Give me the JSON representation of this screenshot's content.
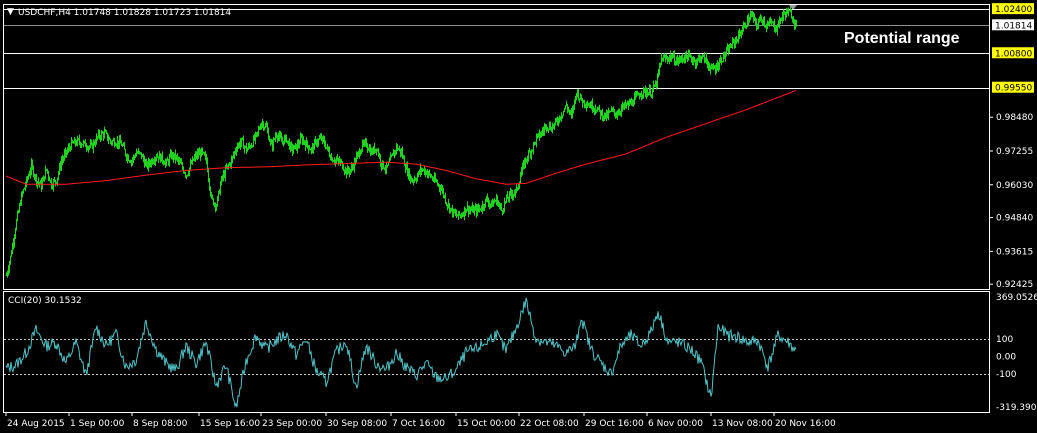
{
  "chart_data": [
    {
      "type": "bar",
      "subtype": "ohlc",
      "symbol_header": "USDCHF,H4  1.01748 1.01828 1.01723 1.01814",
      "annotation": "Potential range",
      "ylim": [
        0.9225,
        1.0255
      ],
      "y_ticks": [
        "0.92425",
        "0.93615",
        "0.94840",
        "0.96030",
        "0.97255",
        "0.98480"
      ],
      "y_tick_values": [
        0.92425,
        0.93615,
        0.9484,
        0.9603,
        0.97255,
        0.9848
      ],
      "current_price": {
        "label": "1.01814",
        "value": 1.01814,
        "color": "#000000",
        "bg": "#ffffff"
      },
      "levels": [
        {
          "label": "1.02400",
          "value": 1.024,
          "color": "#ffffff",
          "badge": "#ffff00"
        },
        {
          "label": "1.00800",
          "value": 1.008,
          "color": "#ffffff",
          "badge": "#ffff00"
        },
        {
          "label": "0.99550",
          "value": 0.9955,
          "color": "#ffffff",
          "badge": "#ffff00"
        }
      ],
      "price_anchors": [
        [
          0,
          0.9275
        ],
        [
          4,
          0.934
        ],
        [
          10,
          0.947
        ],
        [
          15,
          0.956
        ],
        [
          20,
          0.9615
        ],
        [
          25,
          0.967
        ],
        [
          30,
          0.962
        ],
        [
          35,
          0.96
        ],
        [
          40,
          0.966
        ],
        [
          45,
          0.9605
        ],
        [
          50,
          0.962
        ],
        [
          55,
          0.969
        ],
        [
          60,
          0.972
        ],
        [
          65,
          0.975
        ],
        [
          72,
          0.976
        ],
        [
          78,
          0.975
        ],
        [
          85,
          0.974
        ],
        [
          92,
          0.978
        ],
        [
          98,
          0.979
        ],
        [
          104,
          0.976
        ],
        [
          110,
          0.976
        ],
        [
          115,
          0.975
        ],
        [
          120,
          0.971
        ],
        [
          125,
          0.969
        ],
        [
          130,
          0.972
        ],
        [
          135,
          0.971
        ],
        [
          140,
          0.967
        ],
        [
          145,
          0.969
        ],
        [
          150,
          0.971
        ],
        [
          155,
          0.97
        ],
        [
          160,
          0.968
        ],
        [
          165,
          0.971
        ],
        [
          170,
          0.97
        ],
        [
          175,
          0.967
        ],
        [
          180,
          0.964
        ],
        [
          185,
          0.968
        ],
        [
          190,
          0.971
        ],
        [
          195,
          0.972
        ],
        [
          200,
          0.969
        ],
        [
          205,
          0.955
        ],
        [
          210,
          0.953
        ],
        [
          215,
          0.962
        ],
        [
          220,
          0.966
        ],
        [
          225,
          0.969
        ],
        [
          230,
          0.974
        ],
        [
          235,
          0.976
        ],
        [
          240,
          0.973
        ],
        [
          245,
          0.975
        ],
        [
          250,
          0.978
        ],
        [
          255,
          0.983
        ],
        [
          260,
          0.981
        ],
        [
          265,
          0.974
        ],
        [
          270,
          0.979
        ],
        [
          275,
          0.976
        ],
        [
          280,
          0.977
        ],
        [
          285,
          0.973
        ],
        [
          290,
          0.974
        ],
        [
          295,
          0.977
        ],
        [
          300,
          0.975
        ],
        [
          305,
          0.973
        ],
        [
          310,
          0.976
        ],
        [
          315,
          0.977
        ],
        [
          320,
          0.974
        ],
        [
          325,
          0.97
        ],
        [
          330,
          0.969
        ],
        [
          335,
          0.968
        ],
        [
          340,
          0.965
        ],
        [
          345,
          0.966
        ],
        [
          350,
          0.97
        ],
        [
          355,
          0.974
        ],
        [
          360,
          0.975
        ],
        [
          365,
          0.972
        ],
        [
          370,
          0.974
        ],
        [
          375,
          0.968
        ],
        [
          380,
          0.966
        ],
        [
          385,
          0.97
        ],
        [
          390,
          0.974
        ],
        [
          395,
          0.972
        ],
        [
          400,
          0.966
        ],
        [
          405,
          0.962
        ],
        [
          410,
          0.963
        ],
        [
          415,
          0.966
        ],
        [
          420,
          0.965
        ],
        [
          425,
          0.963
        ],
        [
          430,
          0.961
        ],
        [
          435,
          0.959
        ],
        [
          440,
          0.954
        ],
        [
          445,
          0.951
        ],
        [
          450,
          0.949
        ],
        [
          455,
          0.9495
        ],
        [
          460,
          0.952
        ],
        [
          465,
          0.951
        ],
        [
          470,
          0.951
        ],
        [
          475,
          0.952
        ],
        [
          480,
          0.955
        ],
        [
          485,
          0.953
        ],
        [
          490,
          0.955
        ],
        [
          495,
          0.951
        ],
        [
          500,
          0.955
        ],
        [
          505,
          0.957
        ],
        [
          510,
          0.958
        ],
        [
          515,
          0.965
        ],
        [
          520,
          0.97
        ],
        [
          525,
          0.973
        ],
        [
          530,
          0.977
        ],
        [
          535,
          0.979
        ],
        [
          540,
          0.982
        ],
        [
          545,
          0.981
        ],
        [
          550,
          0.983
        ],
        [
          555,
          0.986
        ],
        [
          560,
          0.989
        ],
        [
          565,
          0.985
        ],
        [
          570,
          0.994
        ],
        [
          575,
          0.991
        ],
        [
          580,
          0.99
        ],
        [
          585,
          0.989
        ],
        [
          590,
          0.988
        ],
        [
          595,
          0.986
        ],
        [
          600,
          0.985
        ],
        [
          605,
          0.987
        ],
        [
          610,
          0.986
        ],
        [
          615,
          0.988
        ],
        [
          620,
          0.989
        ],
        [
          625,
          0.99
        ],
        [
          630,
          0.992
        ],
        [
          635,
          0.994
        ],
        [
          640,
          0.994
        ],
        [
          645,
          0.994
        ],
        [
          650,
          0.997
        ],
        [
          655,
          1.006
        ],
        [
          660,
          1.006
        ],
        [
          665,
          1.007
        ],
        [
          670,
          1.005
        ],
        [
          675,
          1.006
        ],
        [
          680,
          1.007
        ],
        [
          685,
          1.006
        ],
        [
          690,
          1.005
        ],
        [
          695,
          1.007
        ],
        [
          700,
          1.005
        ],
        [
          705,
          1.002
        ],
        [
          710,
          1.003
        ],
        [
          715,
          1.006
        ],
        [
          720,
          1.008
        ],
        [
          725,
          1.011
        ],
        [
          730,
          1.013
        ],
        [
          735,
          1.016
        ],
        [
          740,
          1.019
        ],
        [
          745,
          1.022
        ],
        [
          750,
          1.018
        ],
        [
          755,
          1.021
        ],
        [
          760,
          1.018
        ],
        [
          765,
          1.019
        ],
        [
          770,
          1.017
        ],
        [
          775,
          1.021
        ],
        [
          780,
          1.023
        ],
        [
          785,
          1.022
        ],
        [
          790,
          1.018
        ]
      ],
      "moving_average": {
        "color": "#ff1a1a",
        "anchors": [
          [
            0,
            0.9635
          ],
          [
            20,
            0.9605
          ],
          [
            60,
            0.9605
          ],
          [
            100,
            0.9618
          ],
          [
            140,
            0.9638
          ],
          [
            180,
            0.9655
          ],
          [
            220,
            0.9665
          ],
          [
            260,
            0.9668
          ],
          [
            300,
            0.9675
          ],
          [
            340,
            0.968
          ],
          [
            380,
            0.9685
          ],
          [
            410,
            0.9678
          ],
          [
            440,
            0.9655
          ],
          [
            470,
            0.9625
          ],
          [
            500,
            0.9605
          ],
          [
            520,
            0.9608
          ],
          [
            550,
            0.9645
          ],
          [
            580,
            0.9678
          ],
          [
            620,
            0.9715
          ],
          [
            660,
            0.9775
          ],
          [
            700,
            0.9825
          ],
          [
            740,
            0.9875
          ],
          [
            790,
            0.9945
          ]
        ]
      }
    },
    {
      "type": "line",
      "indicator": "CCI(20) 30.1532",
      "ylim": [
        -319.39,
        369.0526
      ],
      "y_ticks": [
        "369.0526",
        "100",
        "0.00",
        "-100",
        "-319.3906"
      ],
      "y_tick_values": [
        369.0526,
        100,
        0,
        -100,
        -319.39
      ],
      "series_color": "#4fc3c8",
      "dotted_levels": [
        100,
        -100
      ],
      "cci_anchors": [
        [
          0,
          -70
        ],
        [
          10,
          -50
        ],
        [
          20,
          20
        ],
        [
          30,
          150
        ],
        [
          40,
          60
        ],
        [
          50,
          80
        ],
        [
          60,
          -40
        ],
        [
          70,
          80
        ],
        [
          80,
          -110
        ],
        [
          90,
          170
        ],
        [
          100,
          60
        ],
        [
          110,
          130
        ],
        [
          120,
          -60
        ],
        [
          130,
          -20
        ],
        [
          140,
          200
        ],
        [
          150,
          40
        ],
        [
          160,
          -40
        ],
        [
          170,
          -80
        ],
        [
          180,
          60
        ],
        [
          190,
          -40
        ],
        [
          200,
          80
        ],
        [
          210,
          -170
        ],
        [
          220,
          -50
        ],
        [
          230,
          -300
        ],
        [
          240,
          -30
        ],
        [
          250,
          120
        ],
        [
          260,
          40
        ],
        [
          270,
          90
        ],
        [
          280,
          130
        ],
        [
          290,
          10
        ],
        [
          300,
          100
        ],
        [
          310,
          -80
        ],
        [
          320,
          -150
        ],
        [
          330,
          20
        ],
        [
          340,
          90
        ],
        [
          350,
          -180
        ],
        [
          360,
          60
        ],
        [
          370,
          -40
        ],
        [
          380,
          -80
        ],
        [
          390,
          20
        ],
        [
          400,
          -60
        ],
        [
          410,
          -110
        ],
        [
          420,
          -40
        ],
        [
          430,
          -120
        ],
        [
          440,
          -130
        ],
        [
          450,
          -80
        ],
        [
          460,
          20
        ],
        [
          470,
          40
        ],
        [
          480,
          80
        ],
        [
          490,
          130
        ],
        [
          500,
          30
        ],
        [
          510,
          160
        ],
        [
          520,
          320
        ],
        [
          530,
          100
        ],
        [
          540,
          80
        ],
        [
          550,
          60
        ],
        [
          560,
          20
        ],
        [
          570,
          60
        ],
        [
          575,
          230
        ],
        [
          585,
          40
        ],
        [
          595,
          -40
        ],
        [
          605,
          -100
        ],
        [
          615,
          60
        ],
        [
          625,
          120
        ],
        [
          635,
          60
        ],
        [
          645,
          140
        ],
        [
          652,
          260
        ],
        [
          662,
          80
        ],
        [
          672,
          80
        ],
        [
          685,
          40
        ],
        [
          695,
          -30
        ],
        [
          705,
          -240
        ],
        [
          712,
          170
        ],
        [
          722,
          120
        ],
        [
          732,
          110
        ],
        [
          742,
          80
        ],
        [
          752,
          90
        ],
        [
          762,
          -60
        ],
        [
          772,
          120
        ],
        [
          782,
          80
        ],
        [
          790,
          30
        ]
      ]
    }
  ],
  "time_axis": {
    "labels": [
      "24 Aug 2015",
      "1 Sep 00:00",
      "8 Sep 08:00",
      "15 Sep 16:00",
      "23 Sep 00:00",
      "30 Sep 08:00",
      "7 Oct 16:00",
      "15 Oct 00:00",
      "22 Oct 08:00",
      "29 Oct 16:00",
      "6 Nov 00:00",
      "13 Nov 08:00",
      "20 Nov 16:00"
    ],
    "positions_bar": [
      0,
      63,
      126,
      193,
      255,
      320,
      385,
      450,
      513,
      578,
      641,
      705,
      768
    ]
  }
}
